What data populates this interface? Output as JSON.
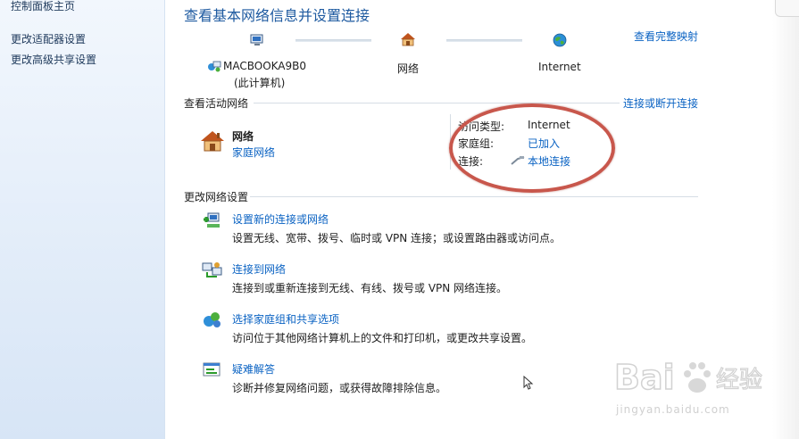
{
  "sidebar": {
    "home": "控制面板主页",
    "links": [
      "更改适配器设置",
      "更改高级共享设置"
    ]
  },
  "page": {
    "title": "查看基本网络信息并设置连接",
    "full_map": "查看完整映射"
  },
  "map": {
    "computer_name": "MACBOOKA9B0",
    "computer_sub": "(此计算机)",
    "network": "网络",
    "internet": "Internet"
  },
  "active": {
    "heading": "查看活动网络",
    "connect_link": "连接或断开连接",
    "net_name": "网络",
    "net_type": "家庭网络",
    "props": [
      {
        "key": "访问类型:",
        "value": "Internet"
      },
      {
        "key": "家庭组:",
        "value": "已加入"
      },
      {
        "key": "连接:",
        "value": "本地连接"
      }
    ]
  },
  "change": {
    "heading": "更改网络设置",
    "tasks": [
      {
        "title": "设置新的连接或网络",
        "desc": "设置无线、宽带、拨号、临时或 VPN 连接；或设置路由器或访问点。"
      },
      {
        "title": "连接到网络",
        "desc": "连接到或重新连接到无线、有线、拨号或 VPN 网络连接。"
      },
      {
        "title": "选择家庭组和共享选项",
        "desc": "访问位于其他网络计算机上的文件和打印机，或更改共享设置。"
      },
      {
        "title": "疑难解答",
        "desc": "诊断并修复网络问题，或获得故障排除信息。"
      }
    ]
  },
  "watermark": {
    "logo": "Baidu经验",
    "url": "jingyan.baidu.com"
  },
  "colors": {
    "link": "#0b63c3",
    "title": "#1e5aa0",
    "annotation_ring": "#c8574c"
  }
}
